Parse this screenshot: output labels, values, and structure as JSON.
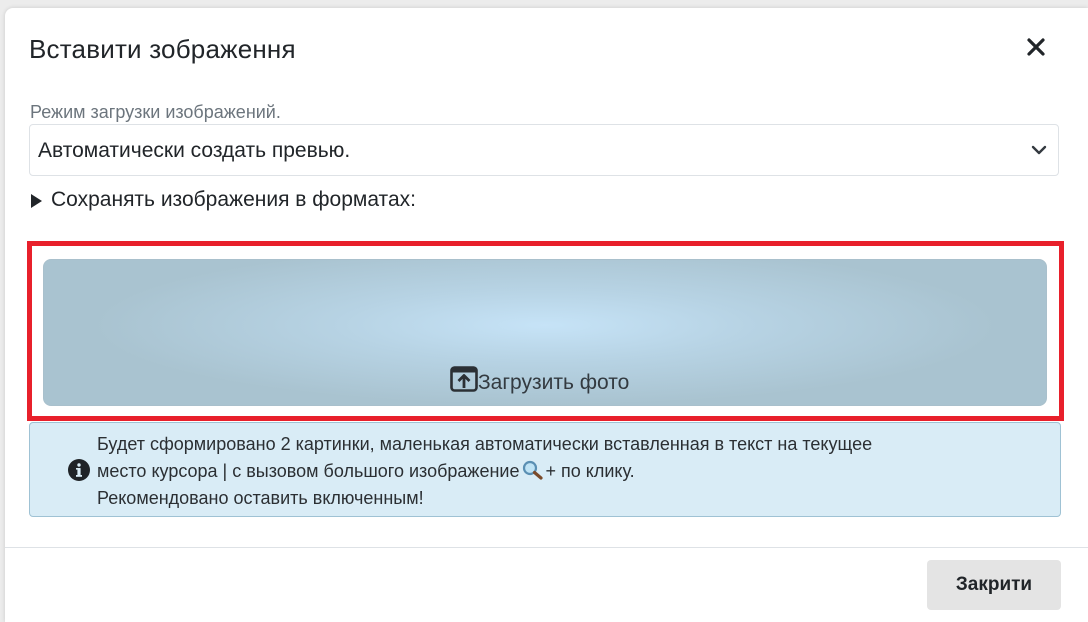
{
  "dialog": {
    "title": "Вставити зображення",
    "close_icon": "close-icon"
  },
  "upload_mode": {
    "label": "Режим загрузки изображений.",
    "selected": "Автоматически создать превью.",
    "chevron_icon": "chevron-down-icon"
  },
  "formats": {
    "label": "Сохранять изображения в форматах:",
    "expanded": false
  },
  "upload": {
    "label": "Загрузить фото",
    "icon": "upload-icon",
    "highlight_color": "#e8202b"
  },
  "info": {
    "icon": "info-icon",
    "line1": "Будет сформировано 2 картинки, маленькая автоматически вставленная в текст на текущее",
    "line2_before": "место курсора | с вызовом большого изображение",
    "line2_icon": "magnifier-icon",
    "line2_after": "+ по клику.",
    "line3": "Рекомендовано оставить включенным!"
  },
  "footer": {
    "close_label": "Закрити"
  }
}
